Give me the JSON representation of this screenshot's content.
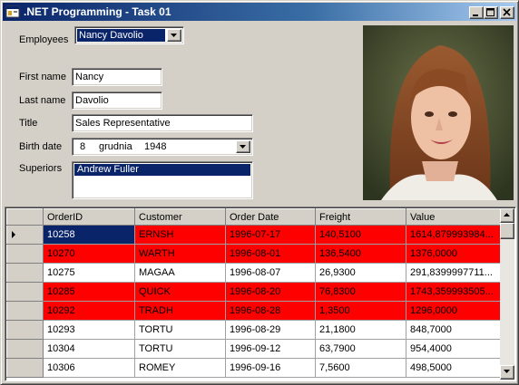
{
  "window": {
    "title": ".NET Programming - Task 01",
    "icon": "app-window-icon",
    "controls": [
      "minimize-icon",
      "maximize-icon",
      "close-icon"
    ]
  },
  "form": {
    "employees_label": "Employees",
    "employees_value": "Nancy Davolio",
    "first_name_label": "First name",
    "first_name_value": "Nancy",
    "last_name_label": "Last name",
    "last_name_value": "Davolio",
    "title_label": "Title",
    "title_value": "Sales Representative",
    "birth_date_label": "Birth date",
    "birth_day": "8",
    "birth_month": "grudnia",
    "birth_year": "1948",
    "superiors_label": "Superiors",
    "superiors_items": [
      "Andrew Fuller"
    ]
  },
  "photo": {
    "description_icon": "employee-photo"
  },
  "grid": {
    "columns": [
      "OrderID",
      "Customer",
      "Order Date",
      "Freight",
      "Value"
    ],
    "rows": [
      {
        "cells": [
          "10258",
          "ERNSH",
          "1996-07-17",
          "140,5100",
          "1614,879993984..."
        ],
        "highlight": true,
        "current": true
      },
      {
        "cells": [
          "10270",
          "WARTH",
          "1996-08-01",
          "136,5400",
          "1376,0000"
        ],
        "highlight": true,
        "current": false
      },
      {
        "cells": [
          "10275",
          "MAGAA",
          "1996-08-07",
          "26,9300",
          "291,8399997711..."
        ],
        "highlight": false,
        "current": false
      },
      {
        "cells": [
          "10285",
          "QUICK",
          "1996-08-20",
          "76,8300",
          "1743,359993505..."
        ],
        "highlight": true,
        "current": false
      },
      {
        "cells": [
          "10292",
          "TRADH",
          "1996-08-28",
          "1,3500",
          "1296,0000"
        ],
        "highlight": true,
        "current": false
      },
      {
        "cells": [
          "10293",
          "TORTU",
          "1996-08-29",
          "21,1800",
          "848,7000"
        ],
        "highlight": false,
        "current": false
      },
      {
        "cells": [
          "10304",
          "TORTU",
          "1996-09-12",
          "63,7900",
          "954,4000"
        ],
        "highlight": false,
        "current": false
      },
      {
        "cells": [
          "10306",
          "ROMEY",
          "1996-09-16",
          "7,5600",
          "498,5000"
        ],
        "highlight": false,
        "current": false
      }
    ],
    "highlight_color": "#ff0000",
    "selection_color": "#0a246a"
  }
}
